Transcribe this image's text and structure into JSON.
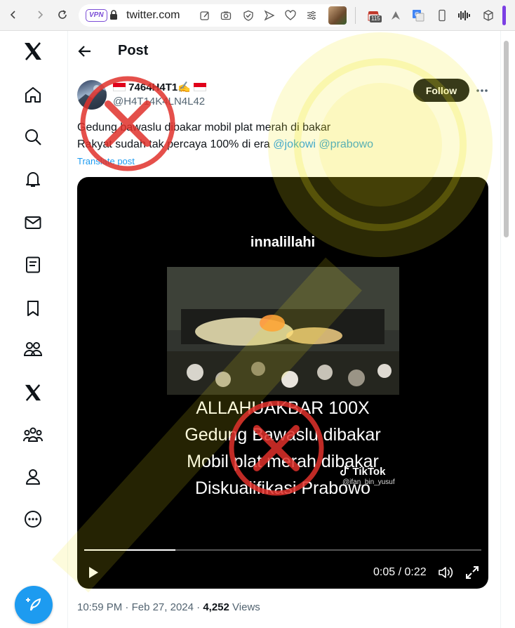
{
  "browser": {
    "url": "twitter.com",
    "vpn_badge": "VPN",
    "extension_badge": "115",
    "colors": {
      "accent": "#7b3fe4"
    }
  },
  "nav_icons": [
    "x-logo-icon",
    "home-icon",
    "search-icon",
    "notifications-icon",
    "messages-icon",
    "lists-icon",
    "bookmarks-icon",
    "communities-icon",
    "premium-icon",
    "verified-orgs-icon",
    "profile-icon",
    "more-icon"
  ],
  "header": {
    "title": "Post"
  },
  "post": {
    "display_name": "7464H4T1✍",
    "handle": "@H4T14K4LN4L42",
    "follow_label": "Follow",
    "text_line1": "Gedung bawaslu dibakar mobil plat merah di bakar",
    "text_line2_prefix": "Rakyat sudah tak percaya 100% di era ",
    "mention1": "@jokowi",
    "mention2": "@prabowo",
    "translate_label": "Translate post",
    "media": {
      "caption": "innalillahi",
      "overlay_line1": "ALLAHUAKBAR 100X",
      "overlay_line2": "Gedung Bawaslu dibakar",
      "overlay_line3": "Mobil plat merah dibakar",
      "overlay_line4": "Diskualifikasi Prabowo",
      "tiktok_label": "TikTok",
      "tiktok_user": "@ifan_bin_yusuf",
      "time_display": "0:05 / 0:22",
      "progress_fraction": 0.23
    },
    "time": "10:59 PM",
    "date": "Feb 27, 2024",
    "views_count": "4,252",
    "views_label": "Views",
    "separator": "·"
  },
  "colors": {
    "x_blue": "#1d9bf0",
    "stamp_red": "#e0312b",
    "watermark_yellow": "#f3e71a"
  }
}
